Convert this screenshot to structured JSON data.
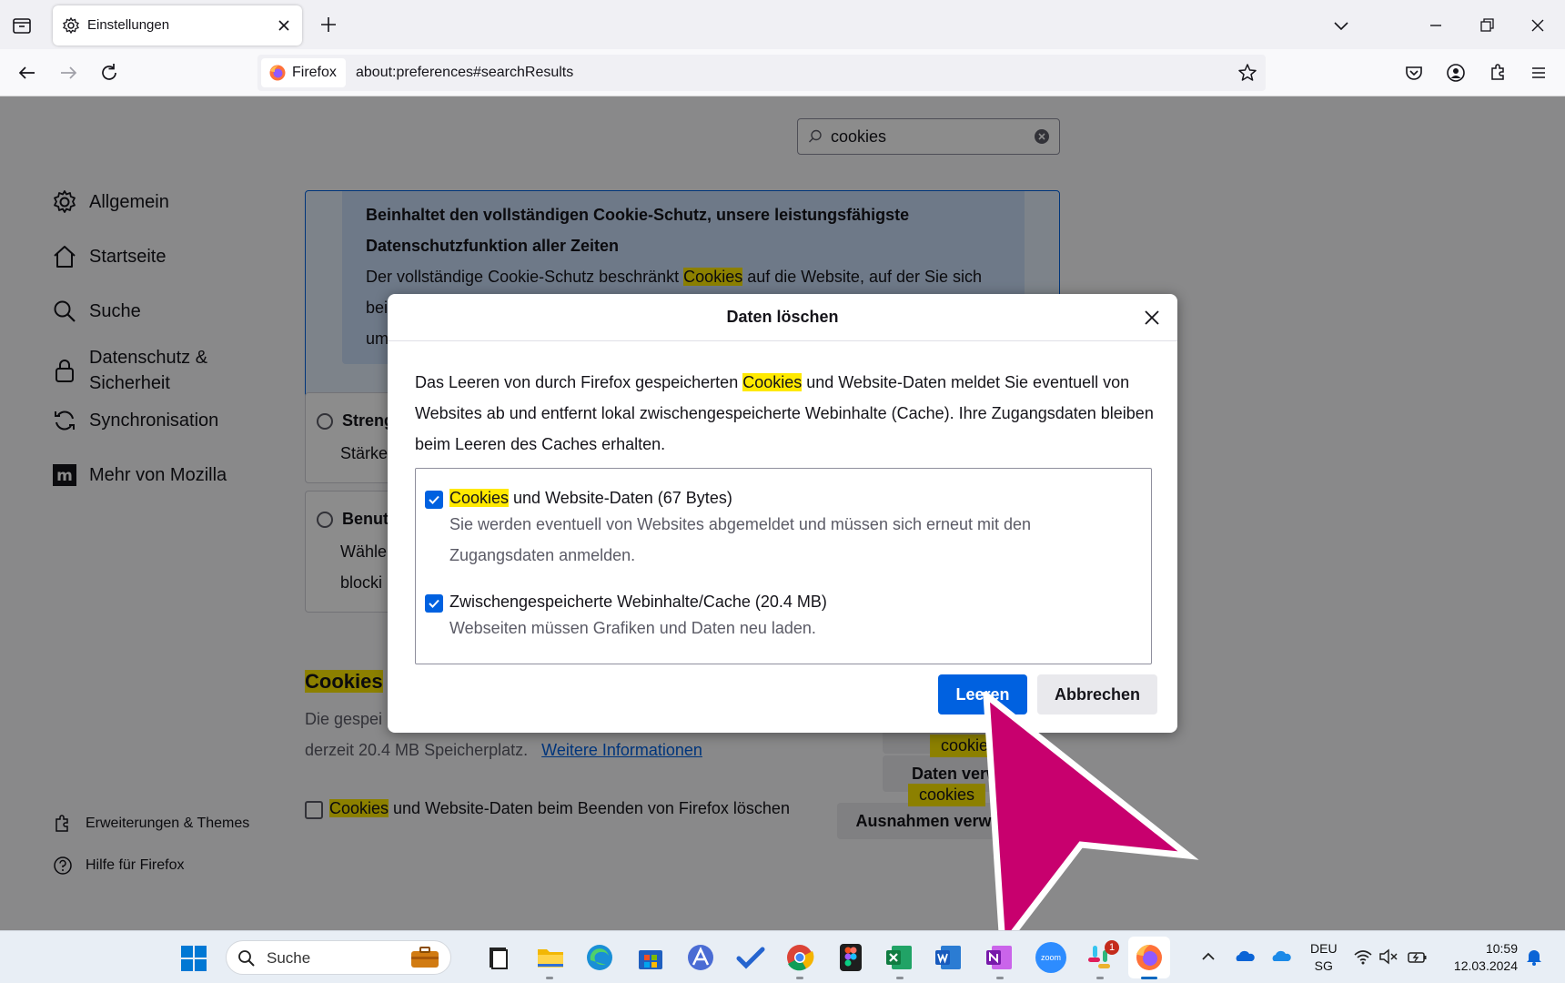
{
  "browser": {
    "tab_title": "Einstellungen",
    "identity_label": "Firefox",
    "url": "about:preferences#searchResults"
  },
  "prefs": {
    "search_value": "cookies",
    "sidebar": [
      {
        "label": "Allgemein",
        "icon": "gear-icon"
      },
      {
        "label": "Startseite",
        "icon": "home-icon"
      },
      {
        "label": "Suche",
        "icon": "search-icon"
      },
      {
        "label": "Datenschutz &",
        "label2": "Sicherheit",
        "icon": "lock-icon"
      },
      {
        "label": "Synchronisation",
        "icon": "sync-icon"
      },
      {
        "label": "Mehr von Mozilla",
        "icon": "mozilla-icon"
      }
    ],
    "sidebar_bottom": [
      {
        "label": "Erweiterungen & Themes",
        "icon": "extensions-icon"
      },
      {
        "label": "Hilfe für Firefox",
        "icon": "help-icon"
      }
    ],
    "strict_card": {
      "line1": "Beinhaltet den vollständigen Cookie-Schutz, unsere leistungsfähigste",
      "line2": "Datenschutzfunktion aller Zeiten",
      "line3_pre": "Der vollständige Cookie-Schutz beschränkt ",
      "line3_hl": "Cookies",
      "line3_post": " auf die Website, auf der Sie sich",
      "line4": "bei",
      "line5": "um"
    },
    "option_strict": {
      "title": "Streng",
      "text": "Stärke"
    },
    "option_custom": {
      "title": "Benut",
      "text1": "Wähle",
      "text2": "blocki"
    },
    "cookies_section": {
      "heading_hl": "Cookies",
      "heading_rest": " u",
      "desc1": "Die gespei",
      "desc2": "derzeit 20.4 MB Speicherplatz.",
      "link": "Weitere Informationen",
      "btn_clear_partial": "",
      "btn_manage_partial": "Daten verw",
      "btn_exceptions_partial": "Ausnahmen verwa",
      "tip1": "cookie",
      "tip2": "cookies",
      "checkbox_hl": "Cookies",
      "checkbox_rest": " und Website-Daten beim Beenden von Firefox löschen"
    }
  },
  "dialog": {
    "title": "Daten löschen",
    "desc_pre": "Das Leeren von durch Firefox gespeicherten ",
    "desc_hl": "Cookies",
    "desc_post": " und Website-Daten meldet Sie eventuell von Websites ab und entfernt lokal zwischengespeicherte Webinhalte (Cache). Ihre Zugangsdaten bleiben beim Leeren des Caches erhalten.",
    "options": [
      {
        "label_hl": "Cookies",
        "label_rest": " und Website-Daten (67 Bytes)",
        "sub": "Sie werden eventuell von Websites abgemeldet und müssen sich erneut mit den Zugangsdaten anmelden.",
        "checked": true
      },
      {
        "label_hl": "",
        "label_rest": "Zwischengespeicherte Webinhalte/Cache (20.4 MB)",
        "sub": "Webseiten müssen Grafiken und Daten neu laden.",
        "checked": true
      }
    ],
    "primary_button": "Leeren",
    "secondary_button": "Abbrechen"
  },
  "taskbar": {
    "search_label": "Suche",
    "lang_line1": "DEU",
    "lang_line2": "SG",
    "time": "10:59",
    "date": "12.03.2024",
    "slack_badge": "1",
    "zoom_label": "zoom"
  },
  "colors": {
    "accent": "#0061e0",
    "highlight": "#ffe900",
    "pointer": "#c8006e"
  }
}
